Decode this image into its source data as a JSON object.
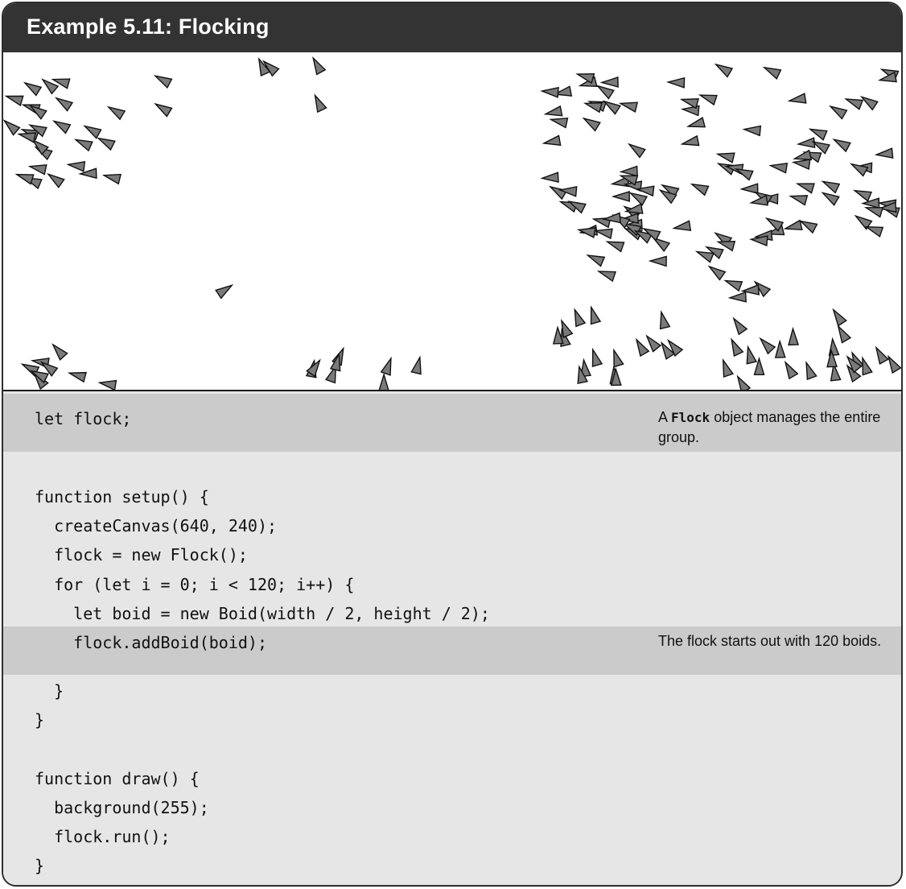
{
  "header": {
    "title": "Example 5.11: Flocking"
  },
  "code": {
    "lines": [
      "let flock;",
      "",
      "function setup() {",
      "  createCanvas(640, 240);",
      "  flock = new Flock();",
      "  for (let i = 0; i < 120; i++) {",
      "    let boid = new Boid(width / 2, height / 2);",
      "    flock.addBoid(boid);",
      "  }",
      "}",
      "",
      "function draw() {",
      "  background(255);",
      "  flock.run();",
      "}"
    ]
  },
  "annotations": {
    "note1": {
      "prefix": "A ",
      "code": "Flock",
      "suffix": " object manages the entire group."
    },
    "note2": {
      "text": "The flock starts out with 120 boids."
    }
  },
  "colors": {
    "title_bar": "#333333",
    "boid_fill": "#7a7a7a",
    "code_bg": "#e6e6e6",
    "highlight": "#cbcbcb"
  }
}
